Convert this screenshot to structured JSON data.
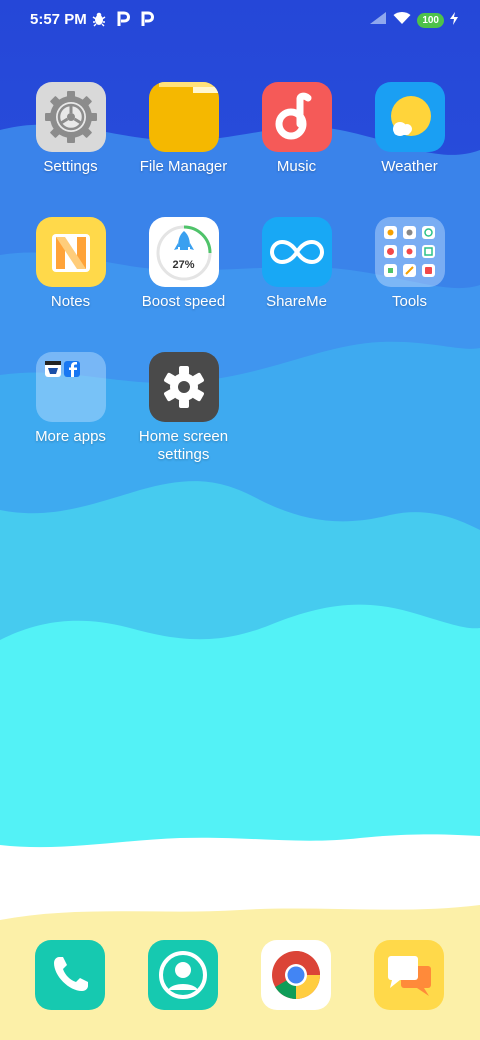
{
  "status_bar": {
    "time": "5:57 PM",
    "battery": "100",
    "icons_left": [
      "bug-icon",
      "p-icon",
      "p-icon"
    ],
    "icons_right": [
      "signal-icon",
      "wifi-icon",
      "battery-icon",
      "charging-icon"
    ]
  },
  "apps": [
    {
      "label": "Settings"
    },
    {
      "label": "File Manager"
    },
    {
      "label": "Music"
    },
    {
      "label": "Weather"
    },
    {
      "label": "Notes"
    },
    {
      "label": "Boost speed",
      "percent_text": "27%"
    },
    {
      "label": "ShareMe"
    },
    {
      "label": "Tools"
    },
    {
      "label": "More apps"
    },
    {
      "label": "Home screen settings"
    }
  ],
  "dock": [
    "phone-icon",
    "contacts-icon",
    "chrome-icon",
    "messages-icon"
  ],
  "colors": {
    "sky": "#2f5fe0",
    "sea_mid": "#3ea0ee",
    "sea_light": "#53f4f6",
    "foam": "#ffffff",
    "sand": "#fcf0a8"
  }
}
